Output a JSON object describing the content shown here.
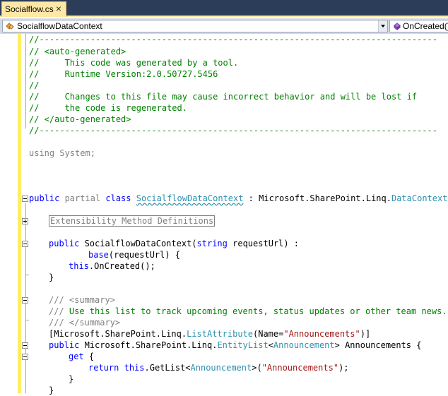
{
  "tab": {
    "title": "Socialflow.cs",
    "close_glyph": "×"
  },
  "nav": {
    "type_combo": {
      "value": "SocialflowDataContext",
      "icon": "class-icon"
    },
    "member_combo": {
      "value": "OnCreated()",
      "icon": "method-icon"
    }
  },
  "colors": {
    "comment": "#008000",
    "keyword": "#0000ff",
    "type": "#2b91af",
    "string": "#a31515",
    "xml_doc": "#808080",
    "change_bar": "#ffee62",
    "tab_active": "#ffe8a6"
  },
  "code": {
    "l1": "//------------------------------------------------------------------------------",
    "l2": "// <auto-generated>",
    "l3": "//     This code was generated by a tool.",
    "l4": "//     Runtime Version:2.0.50727.5456",
    "l5": "//",
    "l6": "//     Changes to this file may cause incorrect behavior and will be lost if",
    "l7": "//     the code is regenerated.",
    "l8": "// </auto-generated>",
    "l9": "//------------------------------------------------------------------------------",
    "using_kw": "using",
    "using_rest": " System;",
    "class_public": "public",
    "class_partial": " partial",
    "class_kw": " class ",
    "class_name": "SocialflowDataContext",
    "class_sep": " : Microsoft.SharePoint.Linq.",
    "class_base": "DataContext",
    "class_brace": " {",
    "region": "Extensibility Method Definitions",
    "ctor_public": "public",
    "ctor_name": " SocialflowDataContext(",
    "ctor_string": "string",
    "ctor_rest": " requestUrl) :",
    "base_kw": "base",
    "base_rest": "(requestUrl) {",
    "this_kw": "this",
    "oncreated": ".OnCreated();",
    "close_brace": "}",
    "doc1_slash": "///",
    "doc1_rest": " <summary>",
    "doc2_slash": "///",
    "doc2_rest": " Use this list to track upcoming events, status updates or other team news.",
    "doc3_slash": "///",
    "doc3_rest": " </summary>",
    "attr_open": "[Microsoft.SharePoint.Linq.",
    "attr_type": "ListAttribute",
    "attr_mid": "(Name=",
    "attr_str": "\"Announcements\"",
    "attr_close": ")]",
    "prop_public": "public",
    "prop_ns": " Microsoft.SharePoint.Linq.",
    "prop_type": "EntityList",
    "prop_lt": "<",
    "prop_generic": "Announcement",
    "prop_rest": "> Announcements {",
    "get_kw": "get",
    "get_brace": " {",
    "return_kw": "return",
    "return_sp": " ",
    "return_this": "this",
    "getlist": ".GetList<",
    "getlist_type": "Announcement",
    "getlist_mid": ">(",
    "getlist_str": "\"Announcements\"",
    "getlist_end": ");",
    "get_close": "}",
    "prop_close": "}"
  }
}
